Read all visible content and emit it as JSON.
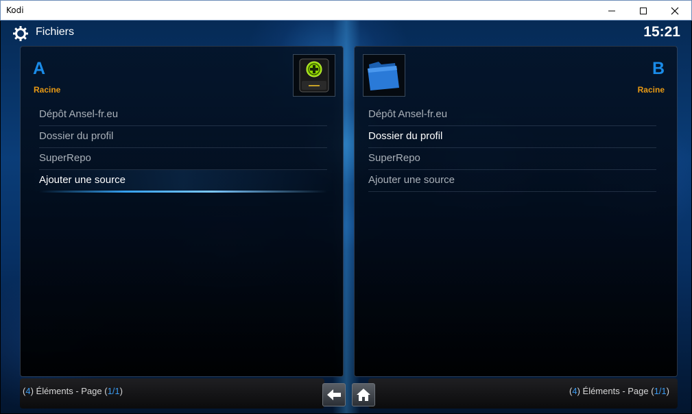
{
  "window": {
    "title": "Kodi",
    "controls": [
      "minimize",
      "maximize",
      "close"
    ]
  },
  "header": {
    "title": "Fichiers",
    "icon": "gear-icon",
    "clock": "15:21"
  },
  "panels": {
    "left": {
      "letter": "A",
      "subtitle": "Racine",
      "thumbnail_icon": "add-drive-icon",
      "items": [
        {
          "label": "Dépôt Ansel-fr.eu"
        },
        {
          "label": "Dossier du profil"
        },
        {
          "label": "SuperRepo"
        },
        {
          "label": "Ajouter une source"
        }
      ],
      "focused_index": 3,
      "footer": {
        "open": "(",
        "count": "4",
        "middle": ") Éléments - Page (",
        "page": "1/1",
        "close": ")"
      }
    },
    "right": {
      "letter": "B",
      "subtitle": "Racine",
      "thumbnail_icon": "blue-folder-icon",
      "items": [
        {
          "label": "Dépôt Ansel-fr.eu"
        },
        {
          "label": "Dossier du profil"
        },
        {
          "label": "SuperRepo"
        },
        {
          "label": "Ajouter une source"
        }
      ],
      "highlighted_index": 1,
      "footer": {
        "open": "(",
        "count": "4",
        "middle": ") Éléments - Page (",
        "page": "1/1",
        "close": ")"
      }
    }
  },
  "nav": {
    "back_icon": "back-arrow-icon",
    "home_icon": "home-icon"
  },
  "colors": {
    "accent_blue": "#1a8be8",
    "subtitle_orange": "#e89a14",
    "item_text": "#a9b0b8",
    "focused_text": "#ffffff"
  }
}
